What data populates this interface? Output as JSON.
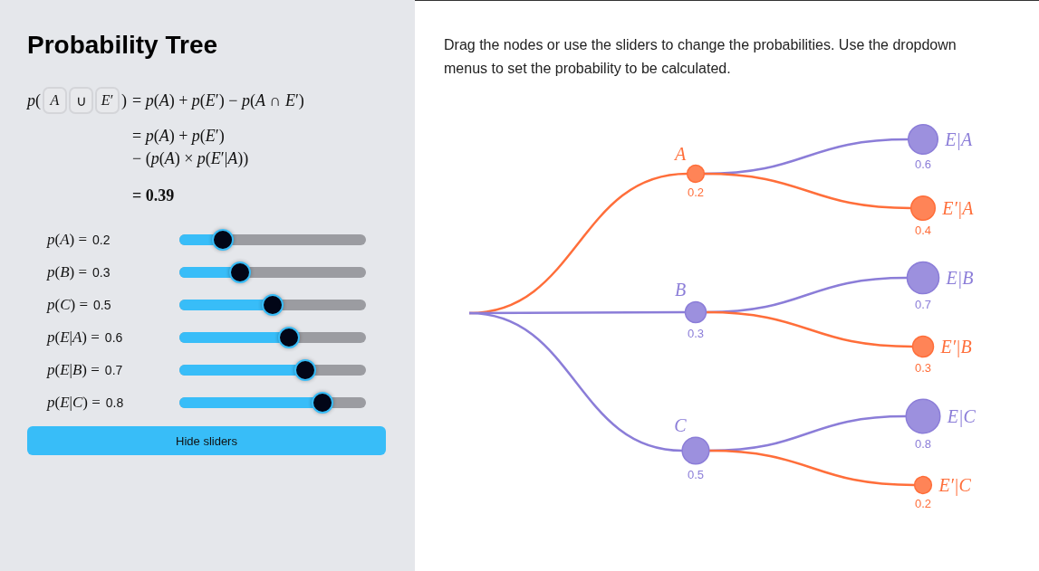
{
  "title": "Probability Tree",
  "formula": {
    "prefix": "*p*(",
    "selectors": [
      {
        "text": "*A*"
      },
      {
        "text": "∪"
      },
      {
        "text": "*E*′"
      }
    ],
    "suffix": ")",
    "lines": [
      "= *p*(*A*) + *p*(*E*′) − *p*(*A* ∩ *E*′)",
      "= *p*(*A*) + *p*(*E*′)",
      "− (*p*(*A*) × *p*(*E*′|*A*))"
    ],
    "result": "= 0.39"
  },
  "sliders": [
    {
      "label": "*p*(*A*) =",
      "value": "0.2",
      "level": 0.2
    },
    {
      "label": "*p*(*B*) =",
      "value": "0.3",
      "level": 0.3
    },
    {
      "label": "*p*(*C*) =",
      "value": "0.5",
      "level": 0.5
    },
    {
      "label": "*p*(*E*|*A*) =",
      "value": "0.6",
      "level": 0.6
    },
    {
      "label": "*p*(*E*|*B*) =",
      "value": "0.7",
      "level": 0.7
    },
    {
      "label": "*p*(*E*|*C*) =",
      "value": "0.8",
      "level": 0.8
    }
  ],
  "hide_button": "Hide sliders",
  "instructions": "Drag the nodes or use the sliders to change the probabilities. Use the dropdown menus to set the probability to be calculated.",
  "tree": {
    "branches": [
      {
        "label": "A",
        "value": "0.2",
        "color": "#ff6e3a",
        "outcomes": [
          {
            "label": "E|A",
            "value": "0.6",
            "color": "#8b7dd8"
          },
          {
            "label": "E′|A",
            "value": "0.4",
            "color": "#ff6e3a"
          }
        ]
      },
      {
        "label": "B",
        "value": "0.3",
        "color": "#8b7dd8",
        "outcomes": [
          {
            "label": "E|B",
            "value": "0.7",
            "color": "#8b7dd8"
          },
          {
            "label": "E′|B",
            "value": "0.3",
            "color": "#ff6e3a"
          }
        ]
      },
      {
        "label": "C",
        "value": "0.5",
        "color": "#8b7dd8",
        "outcomes": [
          {
            "label": "E|C",
            "value": "0.8",
            "color": "#8b7dd8"
          },
          {
            "label": "E′|C",
            "value": "0.2",
            "color": "#ff6e3a"
          }
        ]
      }
    ]
  }
}
